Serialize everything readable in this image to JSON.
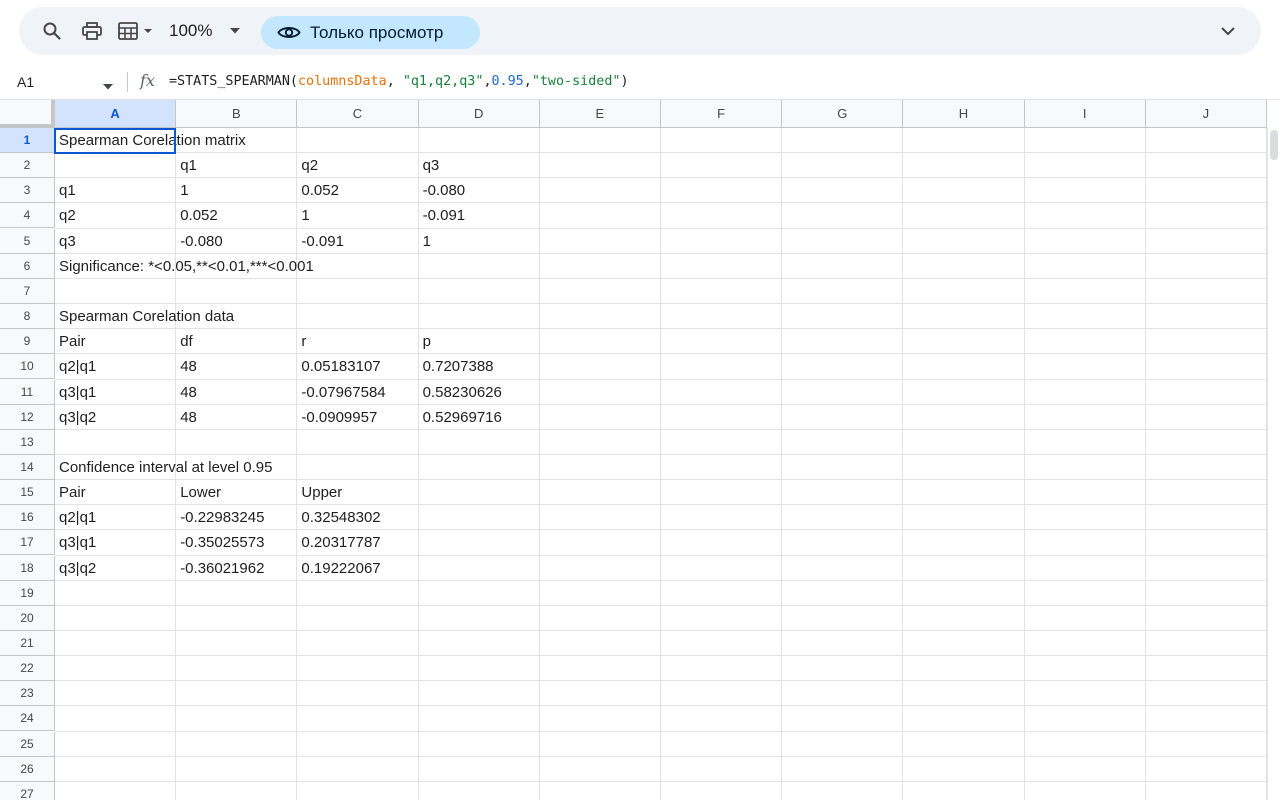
{
  "toolbar": {
    "search_icon": "search-icon",
    "print_icon": "print-icon",
    "format_icon": "paint-format-icon",
    "zoom": "100%",
    "view_mode": "Только просмотр",
    "accent": "#c2e7ff"
  },
  "formula_bar": {
    "cell_ref": "A1",
    "fx": "fx",
    "formula_fn": "=STATS_SPEARMAN(",
    "formula_range": "columnsData",
    "formula_sep1": ", ",
    "formula_str1": "\"q1,q2,q3\"",
    "formula_sep2": ",",
    "formula_num": "0.95",
    "formula_sep3": ",",
    "formula_str2": "\"two-sided\"",
    "formula_close": ")"
  },
  "sheet": {
    "columns": [
      "A",
      "B",
      "C",
      "D",
      "E",
      "F",
      "G",
      "H",
      "I",
      "J"
    ],
    "rows": [
      "1",
      "2",
      "3",
      "4",
      "5",
      "6",
      "7",
      "8",
      "9",
      "10",
      "11",
      "12",
      "13",
      "14",
      "15",
      "16",
      "17",
      "18",
      "19",
      "20",
      "21",
      "22",
      "23",
      "24",
      "25",
      "26",
      "27"
    ],
    "selected_cell": "A1",
    "cells": {
      "r1": [
        "Spearman Corelation matrix",
        "",
        "",
        ""
      ],
      "r2": [
        "",
        "q1",
        "q2",
        "q3"
      ],
      "r3": [
        "q1",
        "1",
        "0.052",
        "-0.080"
      ],
      "r4": [
        "q2",
        "0.052",
        "1",
        "-0.091"
      ],
      "r5": [
        "q3",
        "-0.080",
        "-0.091",
        "1"
      ],
      "r6": [
        "Significance: *<0.05,**<0.01,***<0.001",
        "",
        "",
        ""
      ],
      "r7": [
        "",
        "",
        "",
        ""
      ],
      "r8": [
        "Spearman Corelation data",
        "",
        "",
        ""
      ],
      "r9": [
        "Pair",
        "df",
        "r",
        "p"
      ],
      "r10": [
        "q2|q1",
        "48",
        "0.05183107",
        "0.7207388"
      ],
      "r11": [
        "q3|q1",
        "48",
        "-0.07967584",
        "0.58230626"
      ],
      "r12": [
        "q3|q2",
        "48",
        "-0.0909957",
        "0.52969716"
      ],
      "r13": [
        "",
        "",
        "",
        ""
      ],
      "r14": [
        "Confidence interval at level 0.95",
        "",
        "",
        ""
      ],
      "r15": [
        "Pair",
        "Lower",
        "Upper",
        ""
      ],
      "r16": [
        "q2|q1",
        "-0.22983245",
        "0.32548302",
        ""
      ],
      "r17": [
        "q3|q1",
        "-0.35025573",
        "0.20317787",
        ""
      ],
      "r18": [
        "q3|q2",
        "-0.36021962",
        "0.19222067",
        ""
      ]
    }
  }
}
